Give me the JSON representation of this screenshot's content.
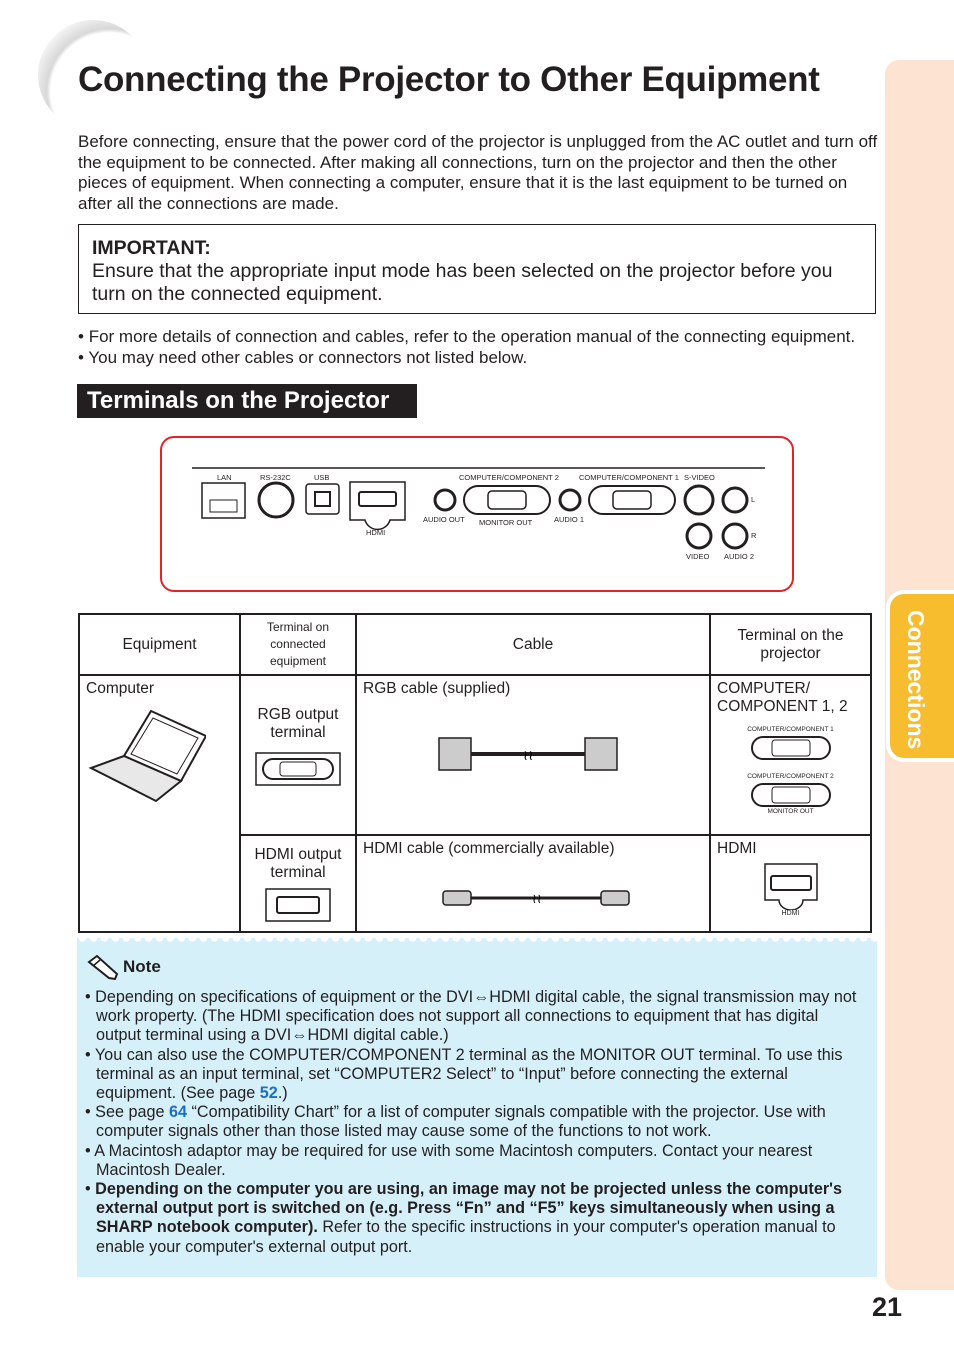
{
  "title": "Connecting the Projector to Other Equipment",
  "intro": "Before connecting, ensure that the power cord of the projector is unplugged from the AC outlet and turn off the equipment to be connected. After making all connections, turn on the projector and then the other pieces of equipment. When connecting a computer, ensure that it is the last equipment to be turned on after all the connections are made.",
  "important": {
    "heading": "IMPORTANT:",
    "text": "Ensure that the appropriate input mode has been selected on the projector before you turn on the connected equipment."
  },
  "bullets": [
    "For more details of connection and cables, refer to the operation manual of the connecting equipment.",
    "You may need other cables or connectors not listed below."
  ],
  "section_title": "Terminals on the Projector",
  "panel_labels": {
    "lan": "LAN",
    "rs232c": "RS-232C",
    "usb": "USB",
    "hdmi": "HDMI",
    "cc2": "COMPUTER/COMPONENT 2",
    "cc1": "COMPUTER/COMPONENT 1",
    "svideo": "S-VIDEO",
    "audio_out": "AUDIO OUT",
    "monitor_out": "MONITOR OUT",
    "audio1": "AUDIO 1",
    "video": "VIDEO",
    "audio2": "AUDIO 2",
    "l": "L",
    "r": "R"
  },
  "table": {
    "headers": [
      "Equipment",
      "Terminal on connected equipment",
      "Cable",
      "Terminal on the projector"
    ],
    "equipment": "Computer",
    "rows": [
      {
        "terminal": "RGB output terminal",
        "cable": "RGB cable (supplied)",
        "projector": "COMPUTER/ COMPONENT 1, 2",
        "port_labels": [
          "COMPUTER/COMPONENT 1",
          "COMPUTER/COMPONENT 2",
          "MONITOR OUT"
        ]
      },
      {
        "terminal": "HDMI output terminal",
        "cable": "HDMI cable (commercially available)",
        "projector": "HDMI",
        "port_labels": [
          "HDMI"
        ]
      }
    ]
  },
  "note": {
    "title": "Note",
    "items": [
      {
        "text": "Depending on specifications of equipment or the DVI⇔HDMI digital cable, the signal transmission may not work property. (The HDMI specification does not support all connections to equipment that has digital output terminal using a DVI⇔HDMI digital cable.)"
      },
      {
        "a": "You can also use the COMPUTER/COMPONENT 2 terminal as the MONITOR OUT terminal. To use this terminal as an input terminal, set “COMPUTER2 Select” to “Input” before connecting the external equipment. (See page ",
        "page": "52",
        "b": ".)"
      },
      {
        "a": "See page ",
        "page": "64",
        "b": " “Compatibility Chart” for a list of computer signals compatible with the projector. Use with computer signals other than those listed may cause some of the functions to not work."
      },
      {
        "text": "A Macintosh adaptor may be required for use with some Macintosh computers. Contact your nearest Macintosh Dealer."
      },
      {
        "bold": "Depending on the computer you are using, an image may not be projected unless the computer's external output port is switched on (e.g. Press “Fn” and “F5” keys simultaneously when using a SHARP notebook computer).",
        "b": " Refer to the specific instructions in your computer's operation manual to enable your computer's external output port."
      }
    ]
  },
  "side_tab": "Connections",
  "page_number": "21",
  "colors": {
    "accent_red": "#e2232a",
    "tab_yellow": "#f8bc2f",
    "side_peach": "#fce3d2",
    "note_bg": "#d6f0fa",
    "link_blue": "#1a6fc4"
  }
}
